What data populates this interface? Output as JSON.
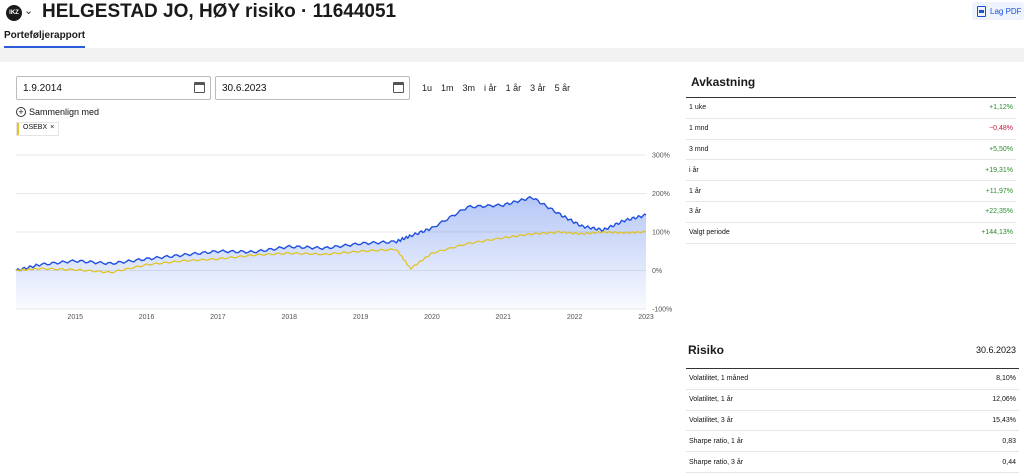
{
  "header": {
    "logo_text": "IKZ",
    "title": "HELGESTAD JO, HØY risiko · 11644051",
    "pdf_label": "Lag PDF"
  },
  "tabs": [
    {
      "label": "Porteføljerapport",
      "active": true
    }
  ],
  "controls": {
    "from_date": "1.9.2014",
    "to_date": "30.6.2023",
    "ranges": [
      "1u",
      "1m",
      "3m",
      "i år",
      "1 år",
      "3 år",
      "5 år"
    ],
    "compare_label": "Sammenlign med",
    "compare_chip": "OSEBX",
    "chip_close": "×"
  },
  "chart_data": {
    "type": "area",
    "x_ticks": [
      "2015",
      "2016",
      "2017",
      "2018",
      "2019",
      "2020",
      "2021",
      "2022",
      "2023"
    ],
    "y_ticks": [
      "300%",
      "200%",
      "100%",
      "0%",
      "-100%"
    ],
    "ylim": [
      -100,
      300
    ],
    "grid": true,
    "series": [
      {
        "name": "",
        "color": "#1f4fe0",
        "x": [
          2014.67,
          2015.0,
          2015.5,
          2016.0,
          2016.5,
          2017.0,
          2017.5,
          2018.0,
          2018.5,
          2019.0,
          2019.5,
          2020.0,
          2020.2,
          2020.5,
          2021.0,
          2021.5,
          2021.9,
          2022.3,
          2022.6,
          2022.9,
          2023.2,
          2023.5
        ],
        "y": [
          0,
          15,
          25,
          18,
          30,
          40,
          50,
          48,
          62,
          58,
          70,
          75,
          90,
          110,
          165,
          170,
          190,
          145,
          115,
          105,
          130,
          144
        ]
      },
      {
        "name": "OSEBX",
        "color": "#e0c21a",
        "x": [
          2014.67,
          2015.0,
          2015.5,
          2016.0,
          2016.5,
          2017.0,
          2017.5,
          2018.0,
          2018.5,
          2019.0,
          2019.5,
          2020.0,
          2020.2,
          2020.5,
          2021.0,
          2021.5,
          2021.9,
          2022.3,
          2022.6,
          2022.9,
          2023.2,
          2023.5
        ],
        "y": [
          0,
          5,
          2,
          -5,
          15,
          25,
          30,
          40,
          45,
          42,
          50,
          55,
          5,
          45,
          70,
          85,
          95,
          100,
          95,
          100,
          98,
          100
        ]
      }
    ]
  },
  "avkastning": {
    "title": "Avkastning",
    "rows": [
      {
        "label": "1 uke",
        "value": "+1,12%",
        "sign": "pos"
      },
      {
        "label": "1 mnd",
        "value": "−0,48%",
        "sign": "neg"
      },
      {
        "label": "3 mnd",
        "value": "+5,50%",
        "sign": "pos"
      },
      {
        "label": "i år",
        "value": "+19,31%",
        "sign": "pos"
      },
      {
        "label": "1 år",
        "value": "+11,97%",
        "sign": "pos"
      },
      {
        "label": "3 år",
        "value": "+22,35%",
        "sign": "pos"
      },
      {
        "label": "Valgt periode",
        "value": "+144,13%",
        "sign": "pos"
      }
    ]
  },
  "risiko": {
    "title": "Risiko",
    "date": "30.6.2023",
    "rows": [
      {
        "label": "Volatilitet, 1 måned",
        "value": "8,10%"
      },
      {
        "label": "Volatilitet, 1 år",
        "value": "12,06%"
      },
      {
        "label": "Volatilitet, 3 år",
        "value": "15,43%"
      },
      {
        "label": "Sharpe ratio, 1 år",
        "value": "0,83"
      },
      {
        "label": "Sharpe ratio, 3 år",
        "value": "0,44"
      }
    ]
  }
}
